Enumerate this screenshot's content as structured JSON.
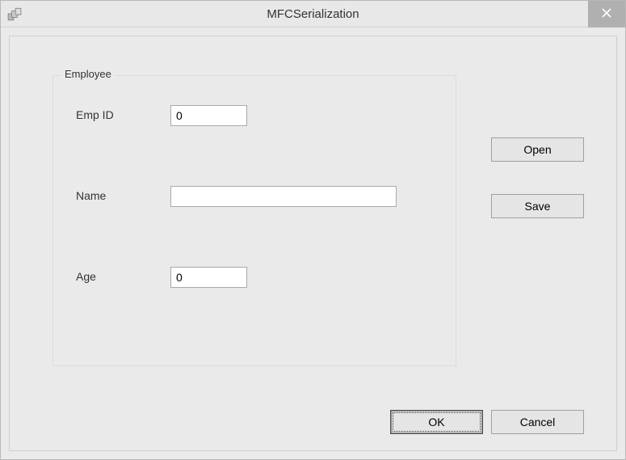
{
  "window": {
    "title": "MFCSerialization"
  },
  "groupbox": {
    "title": "Employee",
    "fields": {
      "empid": {
        "label": "Emp ID",
        "value": "0"
      },
      "name": {
        "label": "Name",
        "value": ""
      },
      "age": {
        "label": "Age",
        "value": "0"
      }
    }
  },
  "buttons": {
    "open": "Open",
    "save": "Save",
    "ok": "OK",
    "cancel": "Cancel"
  }
}
